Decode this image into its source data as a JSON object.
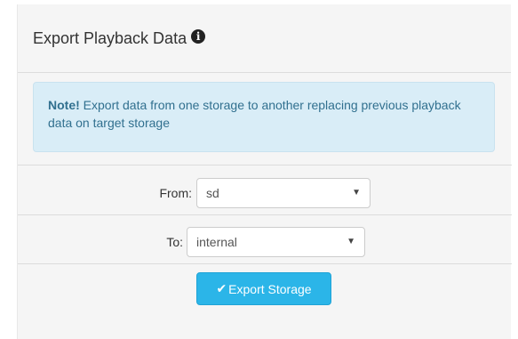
{
  "panel": {
    "title": "Export Playback Data",
    "info_icon": "info-circle-icon",
    "info_glyph": "i"
  },
  "note": {
    "strong": "Note!",
    "text": " Export data from one storage to another replacing previous playback data on target storage"
  },
  "form": {
    "from_label": "From:",
    "from_value": "sd",
    "to_label": "To:",
    "to_value": "internal",
    "caret_glyph": "▼"
  },
  "button": {
    "icon": "check-icon",
    "icon_glyph": "✔",
    "label": "Export Storage"
  },
  "colors": {
    "note_bg": "#d9edf7",
    "note_text": "#31708f",
    "button_bg": "#2bb5e8"
  }
}
